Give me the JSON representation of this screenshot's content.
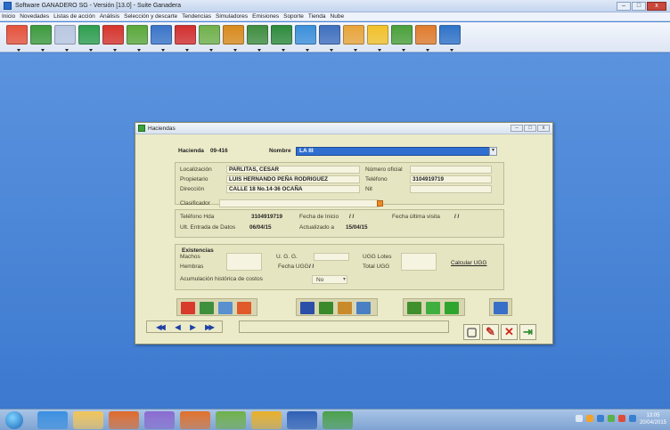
{
  "app": {
    "title": "Software GANADERO SG  -  Versión [13.0] - Suite Ganadera",
    "min": "–",
    "max": "□",
    "close": "x"
  },
  "menu": [
    "Inicio",
    "Novedades",
    "Listas de acción",
    "Análisis",
    "Selección y descarte",
    "Tendencias",
    "Simuladores",
    "Emisiones",
    "Soporte",
    "Tienda",
    "Nube"
  ],
  "toolbar_icons": [
    {
      "name": "home-icon",
      "color": "#e5533c"
    },
    {
      "name": "cattle-icon",
      "color": "#3d9a3d"
    },
    {
      "name": "cow-icon",
      "color": "#b8c7e0"
    },
    {
      "name": "sd-icon",
      "color": "#2e9e4f"
    },
    {
      "name": "syringe-icon",
      "color": "#d6342c"
    },
    {
      "name": "feed-icon",
      "color": "#5aa83a"
    },
    {
      "name": "vaccine-icon",
      "color": "#3a74c8"
    },
    {
      "name": "medical-icon",
      "color": "#d22e2e"
    },
    {
      "name": "pasture-icon",
      "color": "#6fb04a"
    },
    {
      "name": "truck-icon",
      "color": "#d98a1c"
    },
    {
      "name": "scale-icon",
      "color": "#3f8d3f"
    },
    {
      "name": "tools-icon",
      "color": "#2e8a3c"
    },
    {
      "name": "cloud-icon",
      "color": "#3b8fd9"
    },
    {
      "name": "report-icon",
      "color": "#3f6fbf"
    },
    {
      "name": "calendar-icon",
      "color": "#e8a43a"
    },
    {
      "name": "idea-icon",
      "color": "#f2c12a"
    },
    {
      "name": "bottle-icon",
      "color": "#4aa03a"
    },
    {
      "name": "grid-icon",
      "color": "#e07b2c"
    },
    {
      "name": "cloud-upload-icon",
      "color": "#2f72c8"
    }
  ],
  "dialog": {
    "title": "Haciendas",
    "hacienda_label": "Hacienda",
    "hacienda_code": "09-416",
    "nombre_label": "Nombre",
    "nombre_value": "LA III",
    "fields": {
      "localizacion_label": "Localización",
      "localizacion_value": "PARLITAS, CESAR",
      "numero_oficial_label": "Número oficial",
      "propietario_label": "Propietario",
      "propietario_value": "LUIS HERNANDO PEÑA RODRIGUEZ",
      "telefono_label": "Teléfono",
      "telefono_value": "3104919719",
      "direccion_label": "Dirección",
      "direccion_value": "CALLE 18 No.14-36 OCAÑA",
      "nit_label": "Nit",
      "clasificador_label": "Clasificador",
      "telefono_hda_label": "Teléfono Hda",
      "telefono_hda_value": "3104919719",
      "fecha_inicio_label": "Fecha de Inicio",
      "fecha_inicio_value": "/ /",
      "fecha_ultima_visita_label": "Fecha última visita",
      "fecha_ultima_visita_value": "/ /",
      "ult_entrada_label": "Ult. Entrada de Datos",
      "ult_entrada_value": "06/04/15",
      "actualizado_label": "Actualizado a",
      "actualizado_value": "15/04/15"
    },
    "existencias": {
      "title": "Existencias",
      "machos_label": "Machos",
      "hembras_label": "Hembras",
      "ugg_label": "U. G. G.",
      "fecha_ugg_label": "Fecha UGG",
      "fecha_ugg_value": "/ /",
      "ugg_lotes_label": "UGG Lotes",
      "total_ugg_label": "Total UGG",
      "calcular_ugg_label": "Calcular UGG",
      "acumulacion_label": "Acumulación histórica de costos",
      "acumulacion_value": "No"
    },
    "icon_bar": [
      {
        "name": "report-icon",
        "color": "#d83a2c"
      },
      {
        "name": "map-icon",
        "color": "#3e8f3e"
      },
      {
        "name": "farm-photo-icon",
        "color": "#5a8fd0"
      },
      {
        "name": "text-a-icon",
        "color": "#e05a2a"
      },
      {
        "name": "settings-icon",
        "color": "#2c4fa8"
      },
      {
        "name": "person-icon",
        "color": "#3a8a2c"
      },
      {
        "name": "chart-icon",
        "color": "#c98a2c"
      },
      {
        "name": "notes-icon",
        "color": "#4a7fc4"
      },
      {
        "name": "money-bag-icon",
        "color": "#3f8f2c"
      },
      {
        "name": "fn-icon",
        "color": "#3fb03f"
      },
      {
        "name": "fv-icon",
        "color": "#2fa52f"
      },
      {
        "name": "camera-icon",
        "color": "#3a6fc8"
      }
    ],
    "nav": {
      "first": "◀◀",
      "prev": "◀",
      "next": "▶",
      "last": "▶▶"
    },
    "actions": [
      {
        "name": "new-record-icon",
        "glyph": "▢",
        "color": "#555"
      },
      {
        "name": "edit-icon",
        "glyph": "✎",
        "color": "#c0362c"
      },
      {
        "name": "delete-icon",
        "glyph": "✕",
        "color": "#d0291e"
      },
      {
        "name": "exit-icon",
        "glyph": "⇥",
        "color": "#2e8a2e"
      }
    ]
  },
  "taskbar": {
    "clock_time": "13:05",
    "clock_date": "20/04/2015",
    "items": [
      {
        "name": "ie-icon",
        "color": "#3a8fe0"
      },
      {
        "name": "explorer-icon",
        "color": "#f2c45a"
      },
      {
        "name": "media-icon",
        "color": "#e06a2a"
      },
      {
        "name": "paint-icon",
        "color": "#8a6ad0"
      },
      {
        "name": "firefox-icon",
        "color": "#e0702a"
      },
      {
        "name": "calc-icon",
        "color": "#6fb04a"
      },
      {
        "name": "chrome-icon",
        "color": "#e8b02a"
      },
      {
        "name": "word-icon",
        "color": "#2f5fb5"
      },
      {
        "name": "ganadero-icon",
        "color": "#4aa04a"
      }
    ],
    "tray": [
      "#e0e8f4",
      "#f2a32a",
      "#3a7fd0",
      "#5ab04a",
      "#e04a3a",
      "#3a7fd0"
    ]
  }
}
